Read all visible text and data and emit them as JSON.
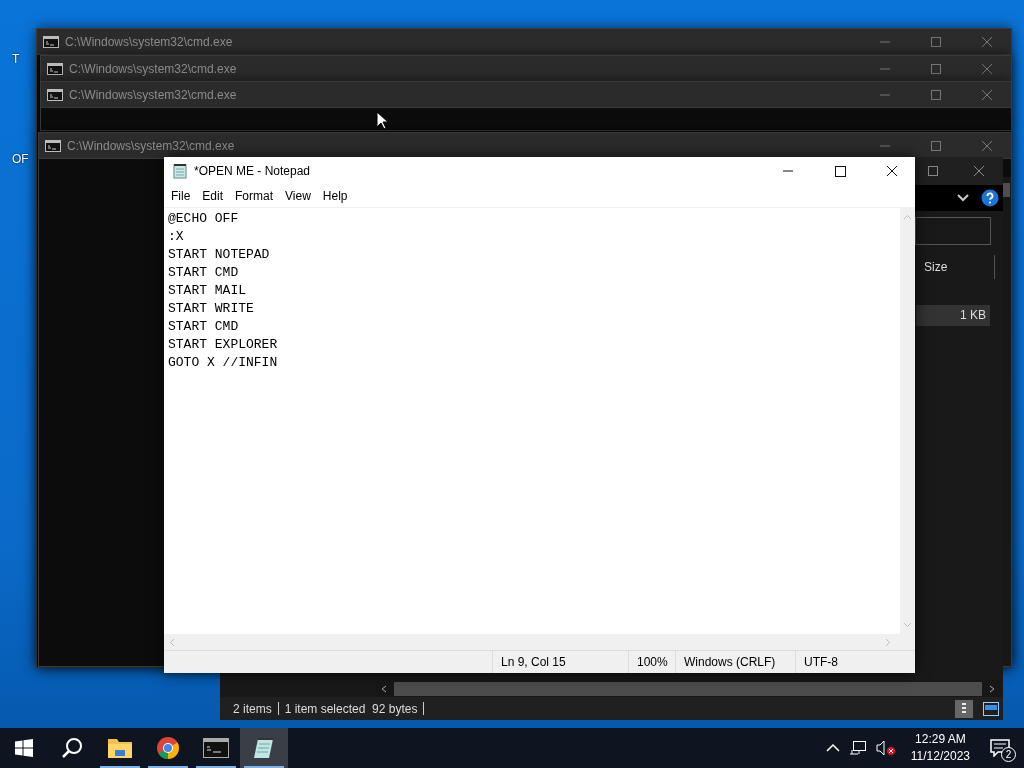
{
  "desktop": {
    "icon_labels": [
      "T",
      "OF"
    ]
  },
  "cmd_windows": [
    {
      "title": "C:\\Windows\\system32\\cmd.exe"
    },
    {
      "title": "C:\\Windows\\system32\\cmd.exe"
    },
    {
      "title": "C:\\Windows\\system32\\cmd.exe"
    },
    {
      "title": "C:\\Windows\\system32\\cmd.exe"
    }
  ],
  "explorer": {
    "column_header": "Size",
    "file_size": "1 KB",
    "status_items": [
      "2 items",
      "1 item selected  92 bytes"
    ]
  },
  "notepad": {
    "title": "*OPEN ME - Notepad",
    "menu": [
      "File",
      "Edit",
      "Format",
      "View",
      "Help"
    ],
    "lines": [
      "@ECHO OFF",
      ":X",
      "START NOTEPAD",
      "START CMD",
      "START MAIL",
      "START WRITE",
      "START CMD",
      "START EXPLORER",
      "GOTO X //INFIN"
    ],
    "status": {
      "position": "Ln 9, Col 15",
      "zoom": "100%",
      "line_endings": "Windows (CRLF)",
      "encoding": "UTF-8"
    }
  },
  "taskbar": {
    "apps": [
      {
        "kind": "explorer",
        "active": false
      },
      {
        "kind": "chrome",
        "active": false
      },
      {
        "kind": "cmd",
        "active": false
      },
      {
        "kind": "notepad",
        "active": true
      }
    ],
    "time": "12:29 AM",
    "date": "11/12/2023",
    "notification_count": "2"
  }
}
